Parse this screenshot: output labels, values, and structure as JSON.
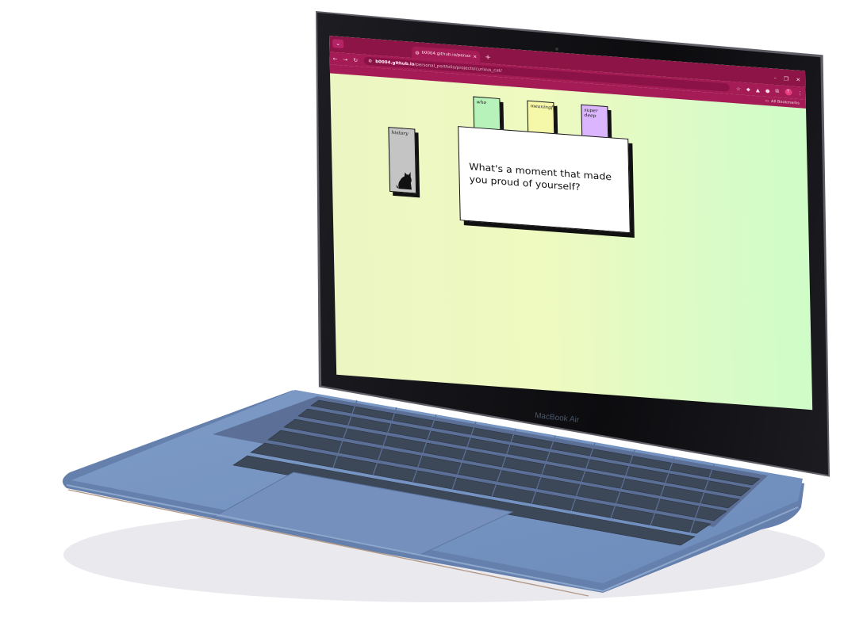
{
  "browser": {
    "tab_title": "b0004.github.io/personal_port",
    "url_host": "b0004.github.io",
    "url_path": "/personal_portfolio/projects/curious_cat/",
    "bookmarks_label": "All Bookmarks",
    "profile_initial": "T",
    "colors": {
      "chrome": "#8d1446",
      "toolbar": "#a41b55"
    }
  },
  "page": {
    "cards": [
      {
        "label": "who",
        "color": "#b6f2b9"
      },
      {
        "label": "meaningful",
        "color": "#f5f7a9"
      },
      {
        "label": "super deep",
        "color": "#dcb5ff"
      },
      {
        "label": "history",
        "color": "#c4c4c4"
      }
    ],
    "prompt": "What's a moment that made you proud of yourself?"
  },
  "device": {
    "brand": "MacBook Air"
  }
}
